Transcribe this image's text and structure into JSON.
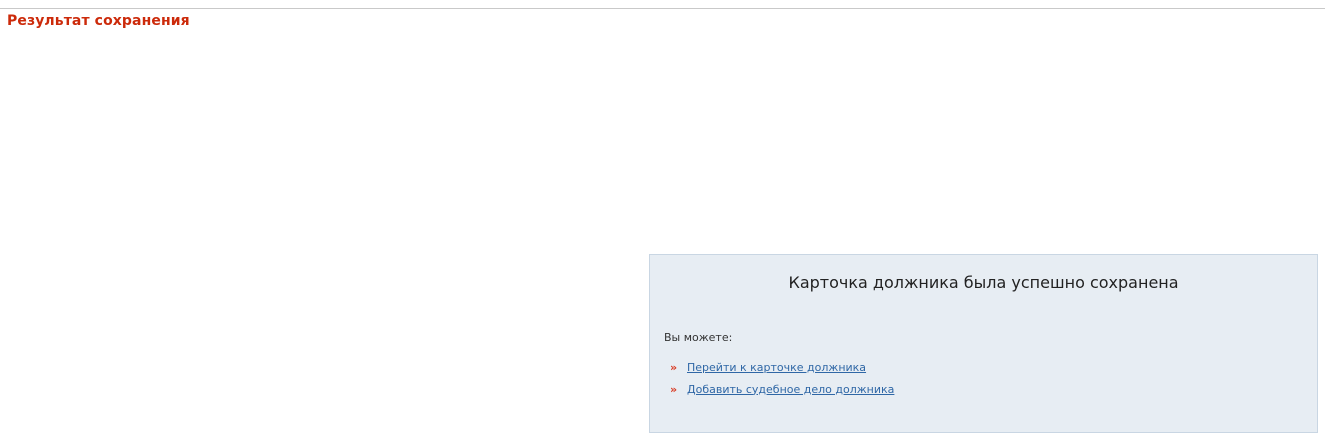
{
  "page": {
    "title": "Результат сохранения"
  },
  "result": {
    "message": "Карточка должника была успешно сохранена",
    "options_label": "Вы можете:",
    "options": [
      {
        "label": "Перейти к карточке должника",
        "bullet": "»"
      },
      {
        "label": "Добавить судебное дело должника",
        "bullet": "»"
      }
    ]
  },
  "colors": {
    "title": "#cc2a0a",
    "panel_background": "#e7edf3",
    "panel_border": "#c9d6e3",
    "link": "#2f67a6",
    "bullet": "#d93a23"
  }
}
